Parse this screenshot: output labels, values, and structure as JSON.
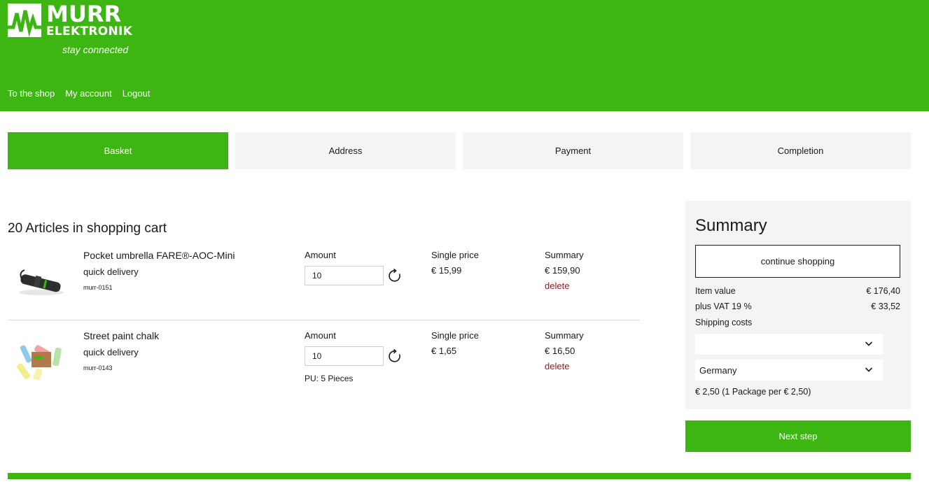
{
  "header": {
    "logo_line1": "MURR",
    "logo_line2": "ELEKTRONIK",
    "tagline": "stay connected",
    "nav": [
      "To the shop",
      "My account",
      "Logout"
    ]
  },
  "steps": [
    "Basket",
    "Address",
    "Payment",
    "Completion"
  ],
  "active_step": "Basket",
  "cart": {
    "title": "20 Articles in shopping cart",
    "amount_label": "Amount",
    "single_price_label": "Single price",
    "summary_label": "Summary",
    "delete_label": "delete",
    "items": [
      {
        "name": "Pocket umbrella FARE®-AOC-Mini",
        "delivery": "quick delivery",
        "sku": "murr-0151",
        "qty": "10",
        "single_price": "€ 15,99",
        "summary": "€ 159,90",
        "pu": ""
      },
      {
        "name": "Street paint chalk",
        "delivery": "quick delivery",
        "sku": "murr-0143",
        "qty": "10",
        "single_price": "€ 1,65",
        "summary": "€ 16,50",
        "pu": "PU: 5 Pieces"
      }
    ]
  },
  "summary": {
    "title": "Summary",
    "continue_label": "continue shopping",
    "item_value_label": "Item value",
    "item_value": "€ 176,40",
    "vat_label": "plus VAT 19 %",
    "vat_value": "€ 33,52",
    "shipping_label": "Shipping costs",
    "shipping_method": "",
    "country": "Germany",
    "shipping_note": "€ 2,50 (1 Package per € 2,50)",
    "next_label": "Next step"
  },
  "colors": {
    "brand_green": "#3db614",
    "delete_red": "#8b1a1a",
    "panel_gray": "#f4f4f4"
  }
}
